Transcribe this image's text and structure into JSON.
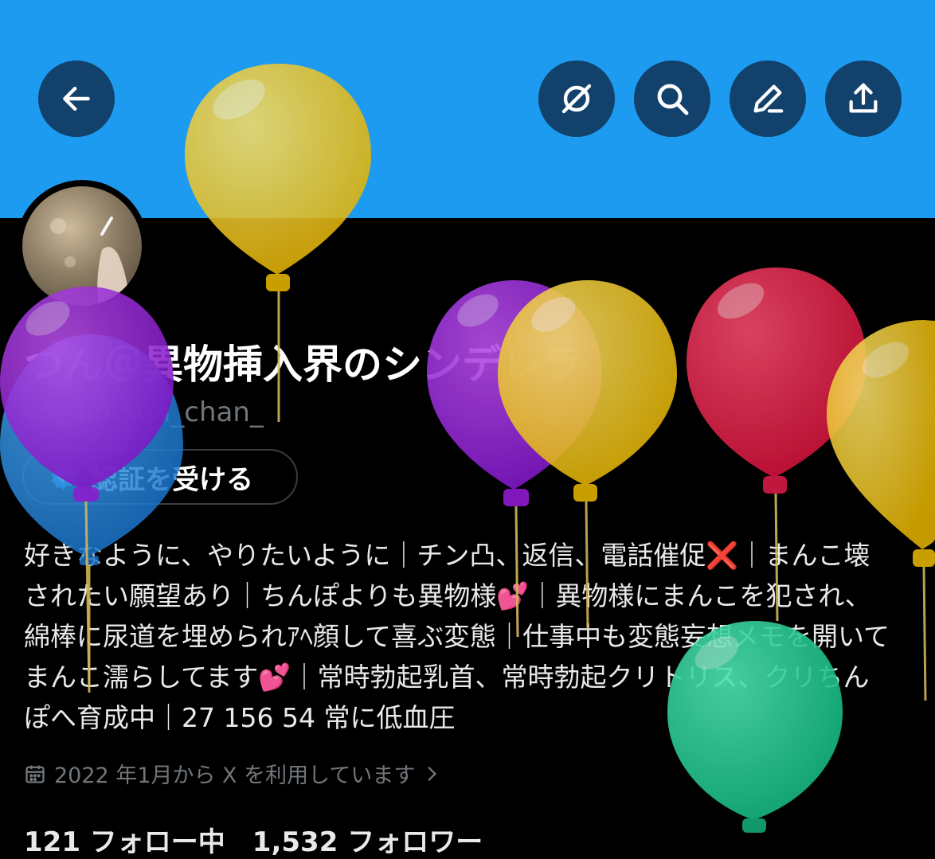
{
  "header": {
    "buttons": [
      {
        "name": "back-button",
        "icon": "arrow-left-icon"
      },
      {
        "name": "mute-button",
        "icon": "slashed-circle-icon"
      },
      {
        "name": "search-button",
        "icon": "search-icon"
      },
      {
        "name": "edit-button",
        "icon": "pencil-icon"
      },
      {
        "name": "share-button",
        "icon": "share-icon"
      }
    ],
    "banner_color": "#1d9bf0"
  },
  "profile": {
    "display_name": "つん＠異物挿入界のシンデレラ",
    "handle": "@tsuntsun_chan_",
    "verify_label": "認証を受ける",
    "bio": "好きなように、やりたいように｜チン凸、返信、電話催促❌｜まんこ壊\nされたい願望あり｜ちんぽよりも異物様💕｜異物様にまんこを犯され、\n綿棒に尿道を埋められｱﾍ顔して喜ぶ変態｜仕事中も変態妄想メモを開いて\nまんこ濡らしてます💕｜常時勃起乳首、常時勃起クリトリス、クリちん\nぽへ育成中｜27 156 54 常に低血圧",
    "joined": "2022 年1月から X を利用しています",
    "joined_icon": "calendar-icon",
    "stats_partial": "121 フォロー中　1,532 フォロワー"
  },
  "overlay": {
    "type": "birthday-balloons",
    "colors": [
      "#f2c200",
      "#9b1fd6",
      "#e8183d",
      "#1fc98b",
      "#1d8fe0"
    ]
  }
}
